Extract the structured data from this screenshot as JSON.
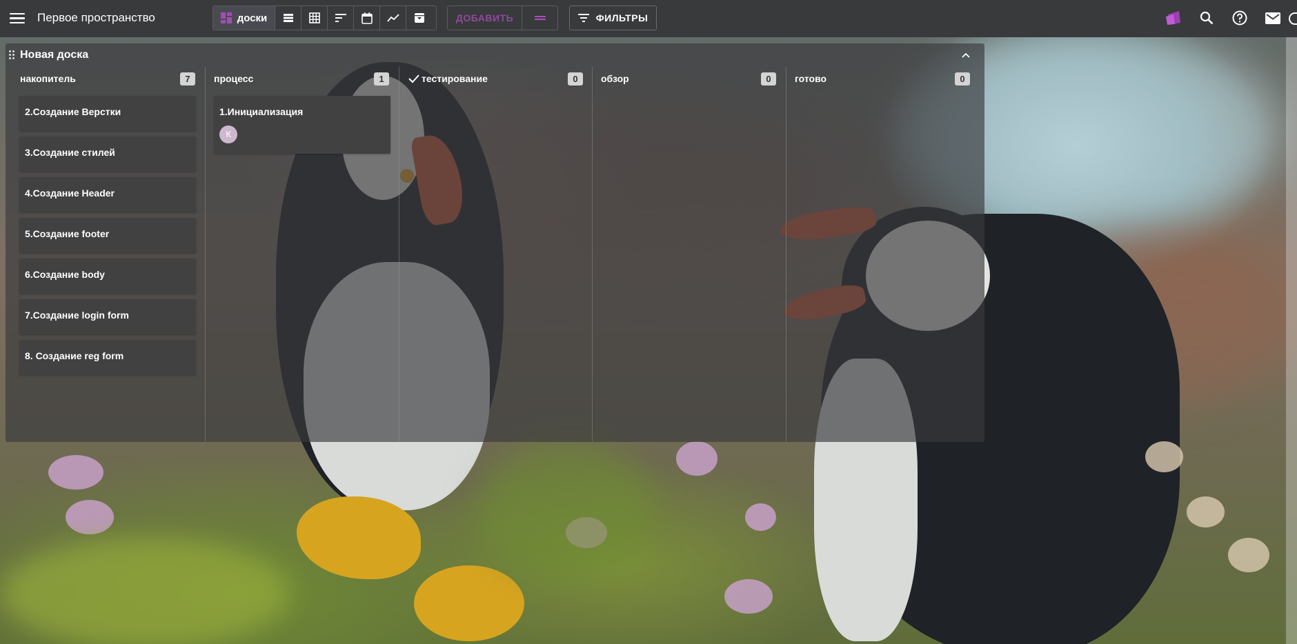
{
  "header": {
    "space_title": "Первое пространство",
    "views": [
      {
        "name": "boards",
        "label": "доски",
        "icon": "boards-icon",
        "active": true
      },
      {
        "name": "list",
        "icon": "list-icon"
      },
      {
        "name": "table",
        "icon": "table-icon"
      },
      {
        "name": "sort",
        "icon": "sort-icon"
      },
      {
        "name": "calendar",
        "icon": "calendar-icon"
      },
      {
        "name": "chart",
        "icon": "chart-icon"
      },
      {
        "name": "archive",
        "icon": "archive-icon"
      }
    ],
    "add_label": "ДОБАВИТЬ",
    "filters_label": "ФИЛЬТРЫ",
    "accent_color": "#9c3fb2",
    "right_icons": [
      "brand-logo-icon",
      "search-icon",
      "help-icon",
      "mail-icon"
    ]
  },
  "board": {
    "title": "Новая доска",
    "columns": [
      {
        "title": "накопитель",
        "count": "7",
        "cards": [
          {
            "title": "2.Создание Верстки"
          },
          {
            "title": "3.Создание стилей"
          },
          {
            "title": "4.Создание Header"
          },
          {
            "title": "5.Создание footer"
          },
          {
            "title": "6.Создание body"
          },
          {
            "title": "7.Создание login form"
          },
          {
            "title": "8. Создание reg form"
          }
        ]
      },
      {
        "title": "процесс",
        "count": "1",
        "cards": [
          {
            "title": "1.Инициализация",
            "assignee_initial": "К"
          }
        ]
      },
      {
        "title": "тестирование",
        "count": "0",
        "icon": "check-icon",
        "cards": []
      },
      {
        "title": "обзор",
        "count": "0",
        "cards": []
      },
      {
        "title": "готово",
        "count": "0",
        "cards": []
      }
    ]
  }
}
